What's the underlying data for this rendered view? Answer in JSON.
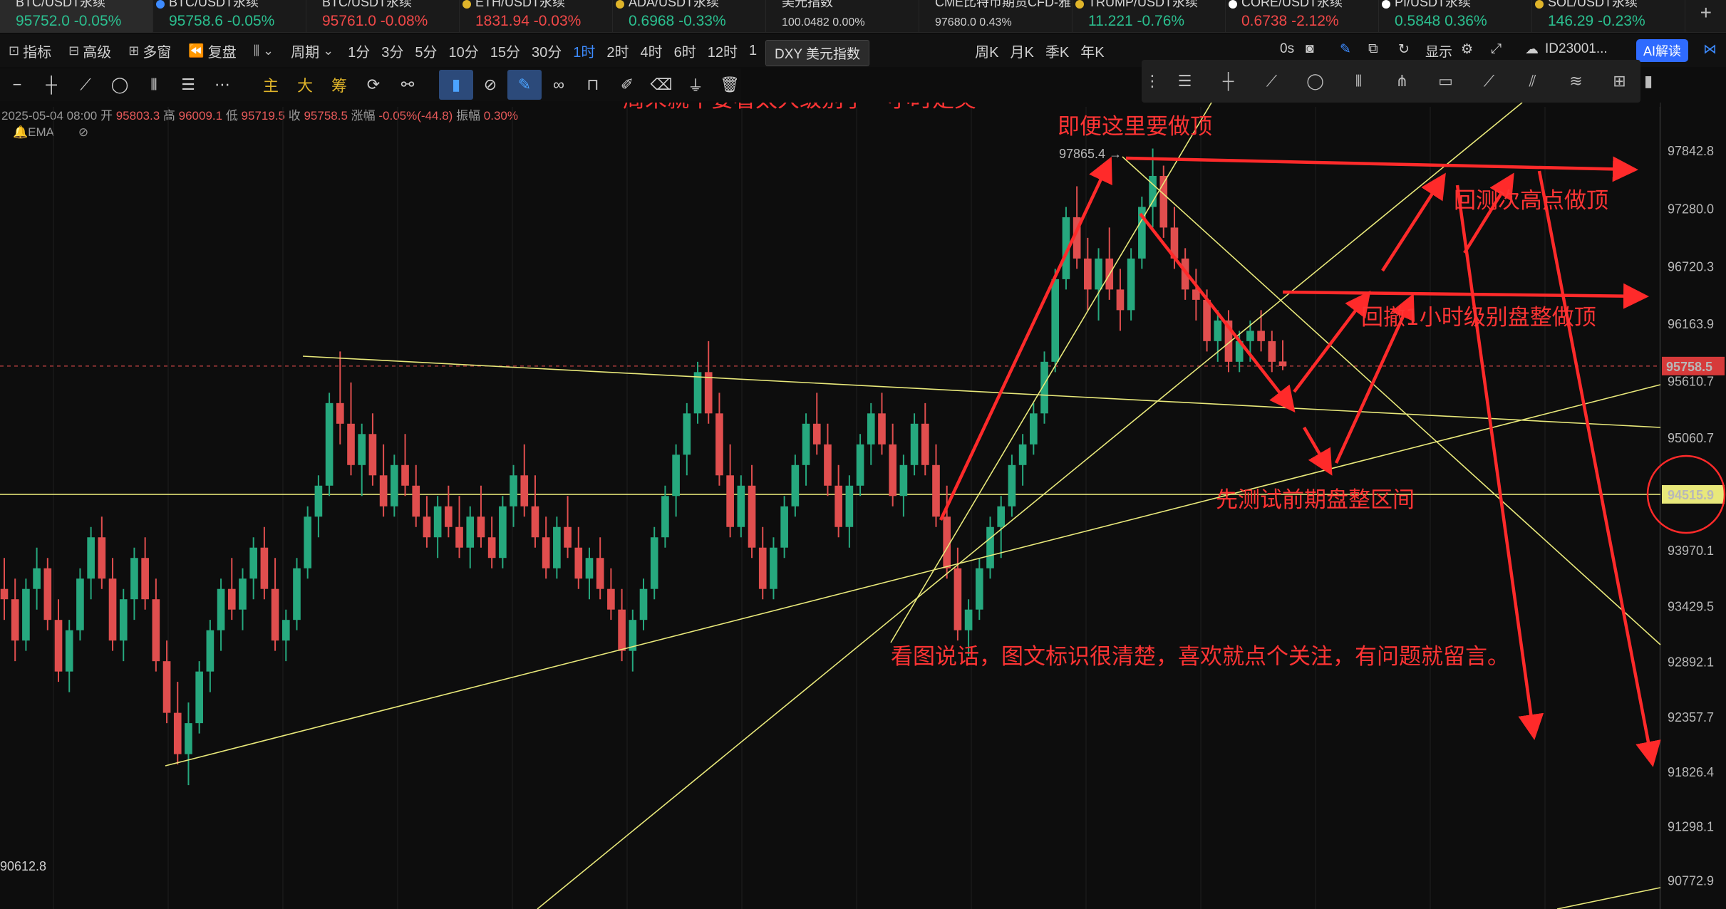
{
  "tickers": [
    {
      "name": "BTC/USDT永续",
      "price": "95752.0",
      "change": "-0.05%",
      "color": "#2bbf8f",
      "dot": "",
      "active": true
    },
    {
      "name": "BTC/USDT永续",
      "price": "95758.6",
      "change": "-0.05%",
      "color": "#2bbf8f",
      "dot": "#3d8bff"
    },
    {
      "name": "BTC/USDT永续",
      "price": "95761.0",
      "change": "-0.08%",
      "color": "#f04848",
      "dot": ""
    },
    {
      "name": "ETH/USDT永续",
      "price": "1831.94",
      "change": "-0.03%",
      "color": "#f04848",
      "dot": "#e0b52a"
    },
    {
      "name": "ADA/USDT永续",
      "price": "0.6968",
      "change": "-0.33%",
      "color": "#2bbf8f",
      "dot": "#e0b52a"
    },
    {
      "name": "美元指数",
      "price": "100.0482",
      "change": "0.00%",
      "color": "#d0d0d0",
      "dot": "",
      "small": true
    },
    {
      "name": "CME比特币期货CFD-雅",
      "price": "97680.0",
      "change": "0.43%",
      "color": "#d0d0d0",
      "dot": "",
      "small": true
    },
    {
      "name": "TRUMP/USDT永续",
      "price": "11.221",
      "change": "-0.76%",
      "color": "#2bbf8f",
      "dot": "#e0b52a"
    },
    {
      "name": "CORE/USDT永续",
      "price": "0.6738",
      "change": "-2.12%",
      "color": "#f04848",
      "dot": "#ffffff"
    },
    {
      "name": "PI/USDT永续",
      "price": "0.5848",
      "change": "0.36%",
      "color": "#2bbf8f",
      "dot": "#ffffff"
    },
    {
      "name": "SOL/USDT永续",
      "price": "146.29",
      "change": "-0.23%",
      "color": "#2bbf8f",
      "dot": "#e0b52a"
    }
  ],
  "add_tab": "+",
  "toolbar": {
    "indicators": "指标",
    "advanced": "高级",
    "multi": "多窗",
    "replay": "复盘",
    "period": "周期",
    "intervals": [
      "1分",
      "3分",
      "5分",
      "10分",
      "15分",
      "30分",
      "1时",
      "2时",
      "4时",
      "6时",
      "12时",
      "1"
    ],
    "intervals_after": [
      "周K",
      "月K",
      "季K",
      "年K"
    ],
    "selected_interval": "1时",
    "tooltip": "DXY 美元指数",
    "right_delay": "0s",
    "right_display": "显示",
    "right_id": "ID23001...",
    "ai": "AI解读"
  },
  "draw_tools": {
    "main": "主",
    "large": "大",
    "chip": "筹"
  },
  "info": {
    "date": "2025-05-04 08:00",
    "open_label": "开",
    "open": "95803.3",
    "high_label": "高",
    "high": "96009.1",
    "low_label": "低",
    "low": "95719.5",
    "close_label": "收",
    "close": "95758.5",
    "chg_label": "涨幅",
    "chg": "-0.05%(-44.8)",
    "amp_label": "振幅",
    "amp": "0.30%",
    "ema": "EMA"
  },
  "price_axis": [
    "97842.8",
    "97280.0",
    "96720.3",
    "96163.9",
    "95610.7",
    "95060.7",
    "93970.1",
    "93429.5",
    "92892.1",
    "92357.7",
    "91826.4",
    "91298.1",
    "90772.9"
  ],
  "current_price": "95758.5",
  "line_price": "94515.9",
  "peak_label": "97865.4",
  "low_label": "90612.8",
  "annotations": {
    "weekend": "周末就不要看太大级别了一小时足矣",
    "top": "即便这里要做顶",
    "retest_high": "回测次高点做顶",
    "pullback": "回撤1小时级别盘整做顶",
    "test_range": "先测试前期盘整区间",
    "note": "看图说话，图文标识很清楚，喜欢就点个关注，有问题就留言。"
  },
  "colors": {
    "up": "#26a87e",
    "down": "#e04e4e",
    "arrow": "#ff2a2a",
    "trend": "#e8e87a"
  },
  "chart_data": {
    "type": "candlestick",
    "interval": "1时",
    "ylim": [
      90500,
      98200
    ],
    "peak": 97865.4,
    "last_close": 95758.5,
    "candles": [
      {
        "o": 93600,
        "h": 93900,
        "l": 93300,
        "c": 93500
      },
      {
        "o": 93500,
        "h": 93700,
        "l": 92900,
        "c": 93100
      },
      {
        "o": 93100,
        "h": 93700,
        "l": 93000,
        "c": 93600
      },
      {
        "o": 93600,
        "h": 94000,
        "l": 93400,
        "c": 93800
      },
      {
        "o": 93800,
        "h": 93900,
        "l": 93200,
        "c": 93300
      },
      {
        "o": 93300,
        "h": 93500,
        "l": 92700,
        "c": 92800
      },
      {
        "o": 92800,
        "h": 93300,
        "l": 92600,
        "c": 93200
      },
      {
        "o": 93200,
        "h": 93800,
        "l": 93100,
        "c": 93700
      },
      {
        "o": 93700,
        "h": 94200,
        "l": 93500,
        "c": 94100
      },
      {
        "o": 94100,
        "h": 94300,
        "l": 93600,
        "c": 93700
      },
      {
        "o": 93700,
        "h": 93900,
        "l": 93000,
        "c": 93100
      },
      {
        "o": 93100,
        "h": 93600,
        "l": 92900,
        "c": 93500
      },
      {
        "o": 93500,
        "h": 94000,
        "l": 93300,
        "c": 93900
      },
      {
        "o": 93900,
        "h": 94100,
        "l": 93400,
        "c": 93500
      },
      {
        "o": 93500,
        "h": 93700,
        "l": 92800,
        "c": 92900
      },
      {
        "o": 92900,
        "h": 93100,
        "l": 92300,
        "c": 92400
      },
      {
        "o": 92400,
        "h": 92700,
        "l": 91900,
        "c": 92000
      },
      {
        "o": 92000,
        "h": 92500,
        "l": 91700,
        "c": 92300
      },
      {
        "o": 92300,
        "h": 92900,
        "l": 92200,
        "c": 92800
      },
      {
        "o": 92800,
        "h": 93300,
        "l": 92600,
        "c": 93200
      },
      {
        "o": 93200,
        "h": 93700,
        "l": 93000,
        "c": 93600
      },
      {
        "o": 93600,
        "h": 93900,
        "l": 93300,
        "c": 93400
      },
      {
        "o": 93400,
        "h": 93800,
        "l": 93200,
        "c": 93700
      },
      {
        "o": 93700,
        "h": 94100,
        "l": 93500,
        "c": 94000
      },
      {
        "o": 94000,
        "h": 94200,
        "l": 93500,
        "c": 93600
      },
      {
        "o": 93600,
        "h": 93900,
        "l": 93000,
        "c": 93100
      },
      {
        "o": 93100,
        "h": 93400,
        "l": 92900,
        "c": 93300
      },
      {
        "o": 93300,
        "h": 93900,
        "l": 93200,
        "c": 93800
      },
      {
        "o": 93800,
        "h": 94400,
        "l": 93700,
        "c": 94300
      },
      {
        "o": 94300,
        "h": 94700,
        "l": 94100,
        "c": 94600
      },
      {
        "o": 94600,
        "h": 95500,
        "l": 94500,
        "c": 95400
      },
      {
        "o": 95400,
        "h": 95900,
        "l": 95000,
        "c": 95200
      },
      {
        "o": 95200,
        "h": 95600,
        "l": 94700,
        "c": 94800
      },
      {
        "o": 94800,
        "h": 95200,
        "l": 94500,
        "c": 95100
      },
      {
        "o": 95100,
        "h": 95300,
        "l": 94600,
        "c": 94700
      },
      {
        "o": 94700,
        "h": 95000,
        "l": 94300,
        "c": 94400
      },
      {
        "o": 94400,
        "h": 94900,
        "l": 94300,
        "c": 94800
      },
      {
        "o": 94800,
        "h": 95100,
        "l": 94500,
        "c": 94600
      },
      {
        "o": 94600,
        "h": 94800,
        "l": 94200,
        "c": 94300
      },
      {
        "o": 94300,
        "h": 94500,
        "l": 94000,
        "c": 94100
      },
      {
        "o": 94100,
        "h": 94500,
        "l": 93900,
        "c": 94400
      },
      {
        "o": 94400,
        "h": 94600,
        "l": 94100,
        "c": 94200
      },
      {
        "o": 94200,
        "h": 94500,
        "l": 93900,
        "c": 94000
      },
      {
        "o": 94000,
        "h": 94400,
        "l": 93800,
        "c": 94300
      },
      {
        "o": 94300,
        "h": 94600,
        "l": 94000,
        "c": 94100
      },
      {
        "o": 94100,
        "h": 94300,
        "l": 93800,
        "c": 93900
      },
      {
        "o": 93900,
        "h": 94500,
        "l": 93800,
        "c": 94400
      },
      {
        "o": 94400,
        "h": 94800,
        "l": 94200,
        "c": 94700
      },
      {
        "o": 94700,
        "h": 95000,
        "l": 94300,
        "c": 94400
      },
      {
        "o": 94400,
        "h": 94700,
        "l": 94000,
        "c": 94100
      },
      {
        "o": 94100,
        "h": 94300,
        "l": 93700,
        "c": 93800
      },
      {
        "o": 93800,
        "h": 94300,
        "l": 93700,
        "c": 94200
      },
      {
        "o": 94200,
        "h": 94500,
        "l": 93900,
        "c": 94000
      },
      {
        "o": 94000,
        "h": 94200,
        "l": 93600,
        "c": 93700
      },
      {
        "o": 93700,
        "h": 94000,
        "l": 93500,
        "c": 93900
      },
      {
        "o": 93900,
        "h": 94100,
        "l": 93500,
        "c": 93600
      },
      {
        "o": 93600,
        "h": 93800,
        "l": 93300,
        "c": 93400
      },
      {
        "o": 93400,
        "h": 93600,
        "l": 92900,
        "c": 93000
      },
      {
        "o": 93000,
        "h": 93400,
        "l": 92800,
        "c": 93300
      },
      {
        "o": 93300,
        "h": 93700,
        "l": 93200,
        "c": 93600
      },
      {
        "o": 93600,
        "h": 94200,
        "l": 93500,
        "c": 94100
      },
      {
        "o": 94100,
        "h": 94600,
        "l": 94000,
        "c": 94500
      },
      {
        "o": 94500,
        "h": 95000,
        "l": 94300,
        "c": 94900
      },
      {
        "o": 94900,
        "h": 95400,
        "l": 94700,
        "c": 95300
      },
      {
        "o": 95300,
        "h": 95800,
        "l": 95200,
        "c": 95700
      },
      {
        "o": 95700,
        "h": 96000,
        "l": 95200,
        "c": 95300
      },
      {
        "o": 95300,
        "h": 95500,
        "l": 94600,
        "c": 94700
      },
      {
        "o": 94700,
        "h": 95000,
        "l": 94100,
        "c": 94200
      },
      {
        "o": 94200,
        "h": 94700,
        "l": 94100,
        "c": 94600
      },
      {
        "o": 94600,
        "h": 94800,
        "l": 93900,
        "c": 94000
      },
      {
        "o": 94000,
        "h": 94200,
        "l": 93500,
        "c": 93600
      },
      {
        "o": 93600,
        "h": 94100,
        "l": 93500,
        "c": 94000
      },
      {
        "o": 94000,
        "h": 94500,
        "l": 93900,
        "c": 94400
      },
      {
        "o": 94400,
        "h": 94900,
        "l": 94300,
        "c": 94800
      },
      {
        "o": 94800,
        "h": 95300,
        "l": 94600,
        "c": 95200
      },
      {
        "o": 95200,
        "h": 95500,
        "l": 94900,
        "c": 95000
      },
      {
        "o": 95000,
        "h": 95200,
        "l": 94500,
        "c": 94600
      },
      {
        "o": 94600,
        "h": 94800,
        "l": 94100,
        "c": 94200
      },
      {
        "o": 94200,
        "h": 94700,
        "l": 94000,
        "c": 94600
      },
      {
        "o": 94600,
        "h": 95100,
        "l": 94500,
        "c": 95000
      },
      {
        "o": 95000,
        "h": 95400,
        "l": 94800,
        "c": 95300
      },
      {
        "o": 95300,
        "h": 95500,
        "l": 94900,
        "c": 95000
      },
      {
        "o": 95000,
        "h": 95200,
        "l": 94400,
        "c": 94500
      },
      {
        "o": 94500,
        "h": 94900,
        "l": 94300,
        "c": 94800
      },
      {
        "o": 94800,
        "h": 95300,
        "l": 94700,
        "c": 95200
      },
      {
        "o": 95200,
        "h": 95400,
        "l": 94700,
        "c": 94800
      },
      {
        "o": 94800,
        "h": 95000,
        "l": 94200,
        "c": 94300
      },
      {
        "o": 94300,
        "h": 94600,
        "l": 93700,
        "c": 93800
      },
      {
        "o": 93800,
        "h": 94000,
        "l": 93100,
        "c": 93200
      },
      {
        "o": 93200,
        "h": 93500,
        "l": 92950,
        "c": 93400
      },
      {
        "o": 93400,
        "h": 93900,
        "l": 93300,
        "c": 93800
      },
      {
        "o": 93800,
        "h": 94300,
        "l": 93700,
        "c": 94200
      },
      {
        "o": 94200,
        "h": 94500,
        "l": 93900,
        "c": 94400
      },
      {
        "o": 94400,
        "h": 94900,
        "l": 94300,
        "c": 94800
      },
      {
        "o": 94800,
        "h": 95100,
        "l": 94600,
        "c": 95000
      },
      {
        "o": 95000,
        "h": 95400,
        "l": 94900,
        "c": 95300
      },
      {
        "o": 95300,
        "h": 95900,
        "l": 95200,
        "c": 95800
      },
      {
        "o": 95800,
        "h": 96700,
        "l": 95700,
        "c": 96600
      },
      {
        "o": 96600,
        "h": 97300,
        "l": 96500,
        "c": 97200
      },
      {
        "o": 97200,
        "h": 97500,
        "l": 96700,
        "c": 96800
      },
      {
        "o": 96800,
        "h": 97000,
        "l": 96300,
        "c": 96500
      },
      {
        "o": 96500,
        "h": 96900,
        "l": 96200,
        "c": 96800
      },
      {
        "o": 96800,
        "h": 97100,
        "l": 96400,
        "c": 96500
      },
      {
        "o": 96500,
        "h": 96700,
        "l": 96100,
        "c": 96300
      },
      {
        "o": 96300,
        "h": 96900,
        "l": 96200,
        "c": 96800
      },
      {
        "o": 96800,
        "h": 97400,
        "l": 96700,
        "c": 97300
      },
      {
        "o": 97300,
        "h": 97865,
        "l": 97100,
        "c": 97600
      },
      {
        "o": 97600,
        "h": 97700,
        "l": 97000,
        "c": 97100
      },
      {
        "o": 97100,
        "h": 97300,
        "l": 96700,
        "c": 96800
      },
      {
        "o": 96800,
        "h": 96900,
        "l": 96400,
        "c": 96500
      },
      {
        "o": 96500,
        "h": 96700,
        "l": 96200,
        "c": 96400
      },
      {
        "o": 96400,
        "h": 96500,
        "l": 95900,
        "c": 96000
      },
      {
        "o": 96000,
        "h": 96300,
        "l": 95800,
        "c": 96200
      },
      {
        "o": 96200,
        "h": 96300,
        "l": 95700,
        "c": 95800
      },
      {
        "o": 95800,
        "h": 96100,
        "l": 95700,
        "c": 96000
      },
      {
        "o": 96000,
        "h": 96200,
        "l": 95800,
        "c": 96100
      },
      {
        "o": 96100,
        "h": 96300,
        "l": 95900,
        "c": 96000
      },
      {
        "o": 96000,
        "h": 96100,
        "l": 95700,
        "c": 95800
      },
      {
        "o": 95803,
        "h": 96009,
        "l": 95719,
        "c": 95758
      }
    ]
  }
}
